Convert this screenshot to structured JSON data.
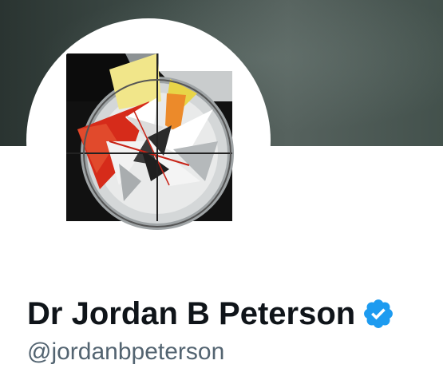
{
  "profile": {
    "display_name": "Dr Jordan B Peterson",
    "handle": "@jordanbpeterson",
    "verified": true
  },
  "icons": {
    "verified": "verified-badge-icon",
    "avatar": "abstract-geometric-logo"
  },
  "colors": {
    "verified_blue": "#1d9bf0",
    "name_text": "#0f1419",
    "handle_text": "#536471",
    "banner": "#3e4b47"
  }
}
